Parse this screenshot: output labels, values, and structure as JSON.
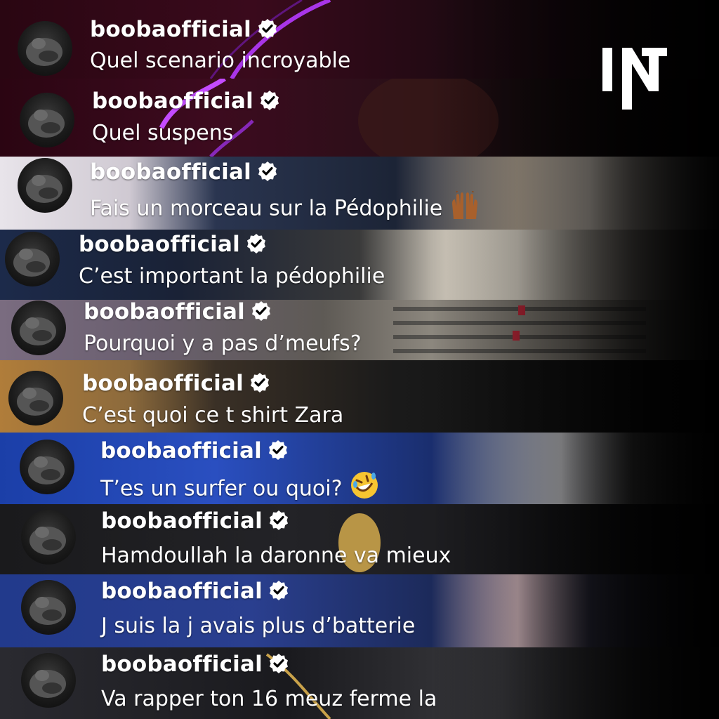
{
  "logo": {
    "label": "IN"
  },
  "colors": {
    "text": "#ffffff",
    "verified_bg": "#ffffff",
    "verified_check": "#000000"
  },
  "comments": [
    {
      "username": "boobaofficial",
      "text": "Quel scenario incroyable",
      "emoji": ""
    },
    {
      "username": "boobaofficial",
      "text": "Quel suspens",
      "emoji": ""
    },
    {
      "username": "boobaofficial",
      "text": "Fais un morceau sur la Pédophilie",
      "emoji": "raised-hands-emoji"
    },
    {
      "username": "boobaofficial",
      "text": "C’est important la pédophilie",
      "emoji": ""
    },
    {
      "username": "boobaofficial",
      "text": "Pourquoi y a pas d’meufs?",
      "emoji": ""
    },
    {
      "username": "boobaofficial",
      "text": "C’est quoi ce t shirt Zara",
      "emoji": ""
    },
    {
      "username": "boobaofficial",
      "text": "T’es un surfer ou quoi?",
      "emoji": "rolling-laughing-emoji"
    },
    {
      "username": "boobaofficial",
      "text": "Hamdoullah la daronne va mieux",
      "emoji": ""
    },
    {
      "username": "boobaofficial",
      "text": "J suis la j avais plus d’batterie",
      "emoji": ""
    },
    {
      "username": "boobaofficial",
      "text": "Va rapper ton 16 meuz ferme la",
      "emoji": ""
    }
  ]
}
